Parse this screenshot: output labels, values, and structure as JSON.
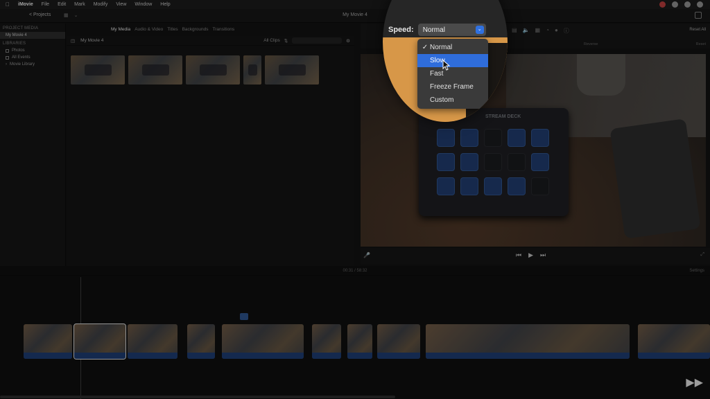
{
  "menubar": {
    "apple": "",
    "app_name": "iMovie",
    "items": [
      "File",
      "Edit",
      "Mark",
      "Modify",
      "View",
      "Window",
      "Help"
    ]
  },
  "toolbar": {
    "back_label": "< Projects",
    "title": "My Movie 4"
  },
  "sidebar": {
    "project_media_header": "PROJECT MEDIA",
    "project_item": "My Movie 4",
    "libraries_header": "LIBRARIES",
    "items": [
      "Photos",
      "All Events",
      "Movie Library"
    ]
  },
  "media_tabs": [
    "My Media",
    "Audio & Video",
    "Titles",
    "Backgrounds",
    "Transitions"
  ],
  "browser": {
    "title": "My Movie 4",
    "filter": "All Clips"
  },
  "viewer": {
    "reset_all": "Reset All",
    "reverse": "Reverse",
    "reset": "Reset",
    "deck_title": "STREAM DECK"
  },
  "timeline": {
    "timecode": "00:31 / 58:32",
    "settings": "Settings"
  },
  "speed": {
    "label": "Speed:",
    "value": "Normal",
    "options": [
      {
        "label": "Normal",
        "checked": true,
        "highlighted": false
      },
      {
        "label": "Slow",
        "checked": false,
        "highlighted": true
      },
      {
        "label": "Fast",
        "checked": false,
        "highlighted": false
      },
      {
        "label": "Freeze Frame",
        "checked": false,
        "highlighted": false
      },
      {
        "label": "Custom",
        "checked": false,
        "highlighted": false
      }
    ]
  },
  "colors": {
    "accent": "#2f6ddb",
    "clip_audio": "#1c3a6c"
  }
}
